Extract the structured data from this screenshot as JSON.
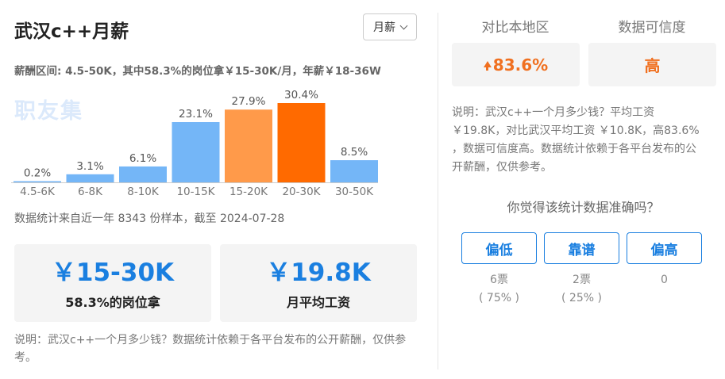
{
  "header": {
    "title": "武汉c++月薪",
    "period_label": "月薪"
  },
  "range_text": "薪酬区间: 4.5-50K，其中58.3%的岗位拿￥15-30K/月，年薪￥18-36W",
  "watermark": "职友集",
  "chart_data": {
    "type": "bar",
    "categories": [
      "4.5-6K",
      "6-8K",
      "8-10K",
      "10-15K",
      "15-20K",
      "20-30K",
      "30-50K"
    ],
    "values": [
      0.2,
      3.1,
      6.1,
      23.1,
      27.9,
      30.4,
      8.5
    ],
    "value_labels": [
      "0.2%",
      "3.1%",
      "6.1%",
      "23.1%",
      "27.9%",
      "30.4%",
      "8.5%"
    ],
    "ylim": [
      0,
      30.4
    ],
    "colors": [
      "#74b6f7",
      "#74b6f7",
      "#74b6f7",
      "#74b6f7",
      "#ff9a4a",
      "#ff6a00",
      "#74b6f7"
    ],
    "title": "",
    "xlabel": "",
    "ylabel": "",
    "grid": false
  },
  "sample_text": "数据统计来自近一年 8343 份样本，截至 2024-07-28",
  "cards": [
    {
      "value": "￥15-30K",
      "label": "58.3%的岗位拿"
    },
    {
      "value": "￥19.8K",
      "label": "月平均工资"
    }
  ],
  "note_left": "说明：武汉c++一个月多少钱？数据统计依赖于各平台发布的公开薪酬，仅供参考。",
  "compare": {
    "local_label": "对比本地区",
    "local_value": "83.6%",
    "trust_label": "数据可信度",
    "trust_value": "高",
    "accent_color": "#f07020"
  },
  "note_right": "说明：武汉c++一个月多少钱？平均工资￥19.8K，对比武汉平均工资 ￥10.8K，高83.6% ，数据可信度高。数据统计依赖于各平台发布的公开薪酬，仅供参考。",
  "vote": {
    "question": "你觉得该统计数据准确吗？",
    "options": [
      {
        "label": "偏低",
        "count": "6票",
        "pct": "( 75% )"
      },
      {
        "label": "靠谱",
        "count": "2票",
        "pct": "( 25% )"
      },
      {
        "label": "偏高",
        "count": "0",
        "pct": ""
      }
    ]
  }
}
